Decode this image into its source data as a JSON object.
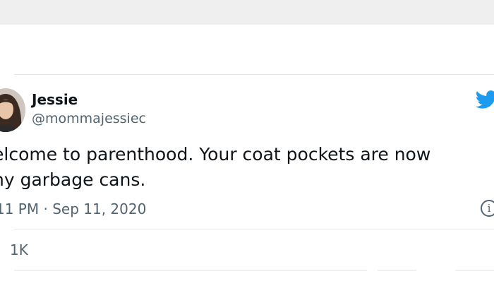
{
  "tweet": {
    "author": {
      "name": "Jessie",
      "handle": "@mommajessiec"
    },
    "text_lines": [
      "elcome to parenthood. Your coat pockets are now",
      "ny garbage cans."
    ],
    "timestamp": "11 PM · Sep 11, 2020",
    "likes": "1K"
  },
  "icons": {
    "brand": "twitter-bird-icon",
    "info": "info-icon"
  },
  "colors": {
    "twitter_blue": "#1d9bf0",
    "secondary_text": "#536471",
    "top_bar": "#efefef"
  }
}
